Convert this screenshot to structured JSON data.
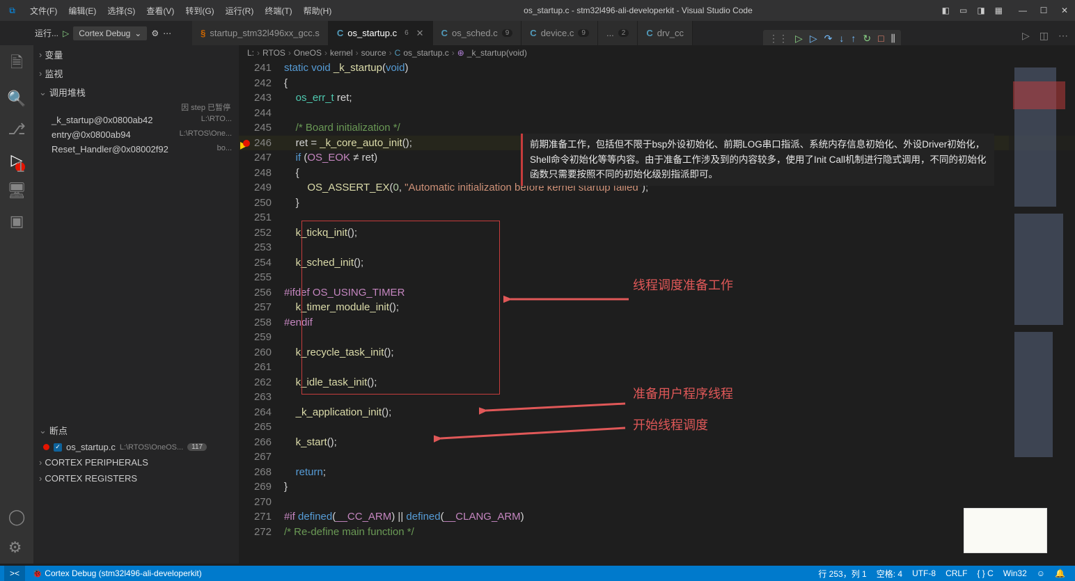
{
  "window": {
    "title": "os_startup.c - stm32l496-ali-developerkit - Visual Studio Code"
  },
  "menu": [
    "文件(F)",
    "编辑(E)",
    "选择(S)",
    "查看(V)",
    "转到(G)",
    "运行(R)",
    "终端(T)",
    "帮助(H)"
  ],
  "debugLauncher": {
    "run": "运行...",
    "config": "Cortex Debug"
  },
  "tabs": [
    {
      "icon": "asm",
      "name": "startup_stm32l496xx_gcc.s",
      "active": false,
      "badge": ""
    },
    {
      "icon": "c",
      "name": "os_startup.c",
      "active": true,
      "badge": "6"
    },
    {
      "icon": "c",
      "name": "os_sched.c",
      "active": false,
      "badge": "9"
    },
    {
      "icon": "c",
      "name": "device.c",
      "active": false,
      "badge": "9"
    },
    {
      "icon": "",
      "name": "...",
      "active": false,
      "badge": "2"
    },
    {
      "icon": "c",
      "name": "drv_cc",
      "active": false,
      "badge": ""
    }
  ],
  "sidebar": {
    "sections": {
      "vars": "变量",
      "watch": "监视",
      "callstack": "调用堆栈",
      "breakpoints": "断点",
      "cortexPeriph": "CORTEX PERIPHERALS",
      "cortexReg": "CORTEX REGISTERS"
    },
    "pausedBy": "因 step 已暂停",
    "stack": [
      {
        "fn": "_k_startup@0x0800ab42",
        "loc": "L:\\RTO..."
      },
      {
        "fn": "entry@0x0800ab94",
        "loc": "L:\\RTOS\\One..."
      },
      {
        "fn": "Reset_Handler@0x08002f92",
        "loc": "bo..."
      }
    ],
    "bp": {
      "file": "os_startup.c",
      "path": "L:\\RTOS\\OneOS...",
      "count": "117"
    }
  },
  "breadcrumb": [
    "L:",
    "RTOS",
    "OneOS",
    "kernel",
    "source",
    "os_startup.c",
    "_k_startup(void)"
  ],
  "code": {
    "startLine": 241,
    "lines": [
      {
        "n": 241,
        "html": "<span class='kw'>static</span> <span class='kw'>void</span> <span class='fn'>_k_startup</span>(<span class='kw'>void</span>)"
      },
      {
        "n": 242,
        "html": "<span class='op'>{</span>"
      },
      {
        "n": 243,
        "html": "    <span class='ty'>os_err_t</span> <span class='op'>ret;</span>"
      },
      {
        "n": 244,
        "html": ""
      },
      {
        "n": 245,
        "html": "    <span class='cm'>/* Board initialization */</span>"
      },
      {
        "n": 246,
        "html": "    <span class='op'>ret = </span><span class='fn'>_k_core_auto_init</span>();",
        "current": true,
        "bp": true,
        "hl": true
      },
      {
        "n": 247,
        "html": "    <span class='kw'>if</span> (<span class='mac'>OS_EOK</span> ≠ ret)"
      },
      {
        "n": 248,
        "html": "    {"
      },
      {
        "n": 249,
        "html": "        <span class='fn'>OS_ASSERT_EX</span>(<span class='num'>0</span>, <span class='str'>\"Automatic initialization before kernel startup failed\"</span>);"
      },
      {
        "n": 250,
        "html": "    }"
      },
      {
        "n": 251,
        "html": ""
      },
      {
        "n": 252,
        "html": "    <span class='fn'>k_tickq_init</span>();"
      },
      {
        "n": 253,
        "html": ""
      },
      {
        "n": 254,
        "html": "    <span class='fn'>k_sched_init</span>();"
      },
      {
        "n": 255,
        "html": ""
      },
      {
        "n": 256,
        "html": "<span class='mac'>#ifdef</span> <span class='mac'>OS_USING_TIMER</span>"
      },
      {
        "n": 257,
        "html": "    <span class='fn'>k_timer_module_init</span>();"
      },
      {
        "n": 258,
        "html": "<span class='mac'>#endif</span>"
      },
      {
        "n": 259,
        "html": ""
      },
      {
        "n": 260,
        "html": "    <span class='fn'>k_recycle_task_init</span>();"
      },
      {
        "n": 261,
        "html": ""
      },
      {
        "n": 262,
        "html": "    <span class='fn'>k_idle_task_init</span>();"
      },
      {
        "n": 263,
        "html": ""
      },
      {
        "n": 264,
        "html": "    <span class='fn'>_k_application_init</span>();"
      },
      {
        "n": 265,
        "html": ""
      },
      {
        "n": 266,
        "html": "    <span class='fn'>k_start</span>();"
      },
      {
        "n": 267,
        "html": ""
      },
      {
        "n": 268,
        "html": "    <span class='kw'>return</span>;"
      },
      {
        "n": 269,
        "html": "<span class='op'>}</span>"
      },
      {
        "n": 270,
        "html": ""
      },
      {
        "n": 271,
        "html": "<span class='mac'>#if</span> <span class='kw'>defined</span>(<span class='mac'>__CC_ARM</span>) || <span class='kw'>defined</span>(<span class='mac'>__CLANG_ARM</span>)"
      },
      {
        "n": 272,
        "html": "<span class='cm'>/* Re-define main function */</span>"
      }
    ]
  },
  "tooltip": "前期准备工作，包括但不限于bsp外设初始化、前期LOG串口指派、系统内存信息初始化、外设Driver初始化，Shell命令初始化等等内容。由于准备工作涉及到的内容较多，使用了Init Call机制进行隐式调用，不同的初始化函数只需要按照不同的初始化级别指派即可。",
  "annotations": {
    "a1": "线程调度准备工作",
    "a2": "准备用户程序线程",
    "a3": "开始线程调度"
  },
  "statusbar": {
    "remote": "><",
    "debug": "Cortex Debug (stm32l496-ali-developerkit)",
    "pos": "行 253，列 1",
    "spaces": "空格: 4",
    "enc": "UTF-8",
    "eol": "CRLF",
    "lang": "C",
    "os": "Win32"
  }
}
